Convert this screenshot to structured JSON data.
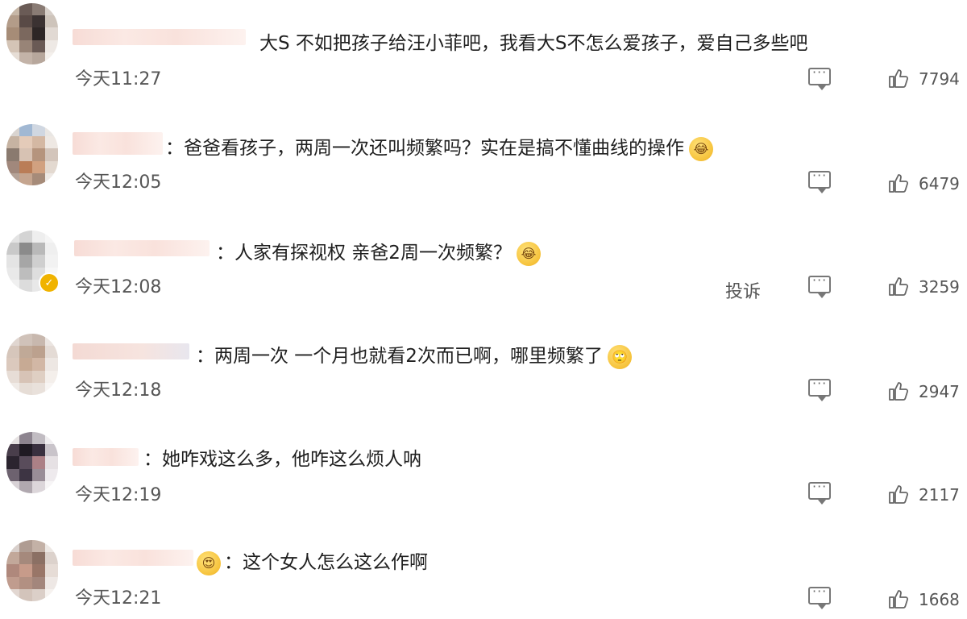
{
  "comments": [
    {
      "text": "大S 不如把孩子给汪小菲吧，我看大S不怎么爱孩子，爱自己多些吧",
      "emoji": "",
      "time": "今天11:27",
      "likes": "7794",
      "report": ""
    },
    {
      "text": "：爸爸看孩子，两周一次还叫频繁吗？实在是搞不懂曲线的操作",
      "emoji": "laughing-tears",
      "time": "今天12:05",
      "likes": "6479",
      "report": ""
    },
    {
      "text": "：人家有探视权 亲爸2周一次频繁？",
      "emoji": "laughing-tears",
      "time": "今天12:08",
      "likes": "3259",
      "report": "投诉"
    },
    {
      "text": "：两周一次 一个月也就看2次而已啊，哪里频繁了",
      "emoji": "thinking-face",
      "time": "今天12:18",
      "likes": "2947",
      "report": ""
    },
    {
      "text": "：她咋戏这么多，他咋这么烦人呐",
      "emoji": "",
      "time": "今天12:19",
      "likes": "2117",
      "report": ""
    },
    {
      "text": "：这个女人怎么这么作啊",
      "emoji": "",
      "time": "今天12:21",
      "likes": "1668",
      "report": ""
    }
  ],
  "icons": {
    "comment": "comment-icon",
    "like": "thumbs-up-icon"
  },
  "colors": {
    "text": "#1f1f1f",
    "meta": "#555555",
    "blurred_name": "#f7dcd6"
  }
}
